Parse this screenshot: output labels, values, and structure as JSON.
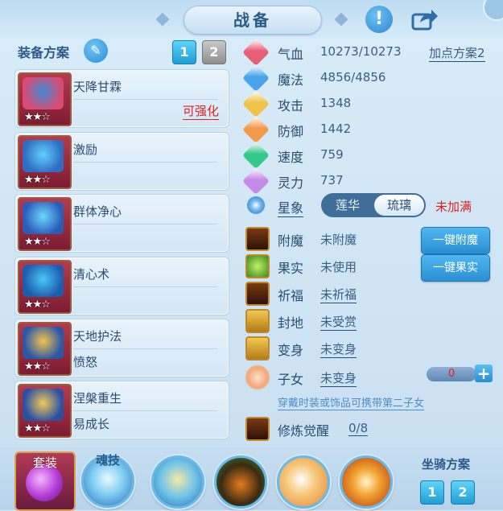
{
  "header": {
    "title": "战备"
  },
  "equip_panel": {
    "title": "装备方案",
    "plan_tabs": [
      "1",
      "2"
    ],
    "items": [
      {
        "name": "天降甘霖",
        "sub": "",
        "action": "可强化",
        "stars": "★★☆",
        "colors": [
          "#d84b73",
          "#3f8ad6"
        ]
      },
      {
        "name": "激励",
        "sub": "",
        "action": "",
        "stars": "★★☆",
        "colors": [
          "#2f6dc2",
          "#5fd0ff"
        ]
      },
      {
        "name": "群体净心",
        "sub": "",
        "action": "",
        "stars": "★★☆",
        "colors": [
          "#2a5cb8",
          "#6ad7ff"
        ]
      },
      {
        "name": "清心术",
        "sub": "",
        "action": "",
        "stars": "★★☆",
        "colors": [
          "#1d5db0",
          "#49c6f6"
        ]
      },
      {
        "name": "天地护法",
        "sub": "愤怒",
        "action": "",
        "stars": "★★☆",
        "colors": [
          "#2a57a8",
          "#f3c44a"
        ]
      },
      {
        "name": "涅槃重生",
        "sub": "易成长",
        "action": "",
        "stars": "★★☆",
        "colors": [
          "#2b4fa3",
          "#f1cc58"
        ]
      }
    ]
  },
  "stats": {
    "points_plan": "加点方案2",
    "rows": [
      {
        "label": "气血",
        "value": "10273/10273",
        "color": "#e85f7a"
      },
      {
        "label": "魔法",
        "value": "4856/4856",
        "color": "#4aa3ea"
      },
      {
        "label": "攻击",
        "value": "1348",
        "color": "#f2c34a"
      },
      {
        "label": "防御",
        "value": "1442",
        "color": "#f39a4a"
      },
      {
        "label": "速度",
        "value": "759",
        "color": "#33c98a"
      },
      {
        "label": "灵力",
        "value": "737",
        "color": "#c58ae6"
      }
    ]
  },
  "constellation": {
    "label": "星象",
    "options": [
      "莲华",
      "琉璃"
    ],
    "selected": "琉璃",
    "status": "未加满"
  },
  "enhancements": {
    "rows": [
      {
        "label": "附魔",
        "value": "未附魔",
        "underline": false
      },
      {
        "label": "果实",
        "value": "未使用",
        "underline": false
      },
      {
        "label": "祈福",
        "value": "未祈福",
        "underline": true
      },
      {
        "label": "封地",
        "value": "未受赏",
        "underline": true
      },
      {
        "label": "变身",
        "value": "未变身",
        "underline": true
      },
      {
        "label": "子女",
        "value": "未变身",
        "underline": true
      }
    ],
    "btn_enchant": "一键附魔",
    "btn_fruit": "一键果实",
    "child_count": "0",
    "child_hint": "穿戴时装或饰品可携带第二子女",
    "awaken_label": "修炼觉醒",
    "awaken_value": "0/8"
  },
  "bottom": {
    "suit_label": "套装",
    "soul_label": "魂技",
    "mount_title": "坐骑方案",
    "mount_tabs": [
      "1",
      "2"
    ]
  }
}
